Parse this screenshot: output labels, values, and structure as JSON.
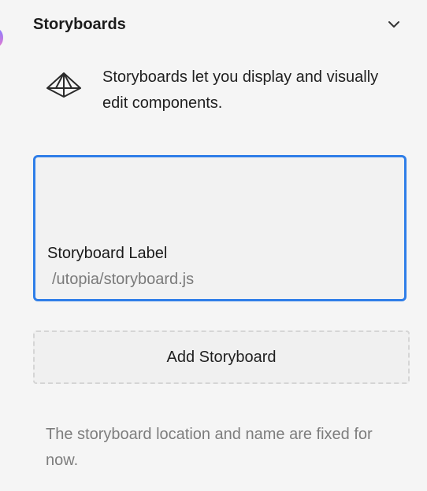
{
  "panel": {
    "title": "Storyboards",
    "collapse_icon": "chevron-down-icon"
  },
  "intro": {
    "icon": "storyboard-icon",
    "text": "Storyboards let you display and visually edit components."
  },
  "storyboard": {
    "label": "Storyboard Label",
    "path": "/utopia/storyboard.js",
    "selected": true
  },
  "actions": {
    "add_label": "Add Storyboard"
  },
  "footnote": {
    "text": "The storyboard location and name are fixed for now."
  },
  "colors": {
    "accent": "#2f7ee8",
    "background": "#f5f5f5",
    "muted_text": "#7d7d7d"
  }
}
